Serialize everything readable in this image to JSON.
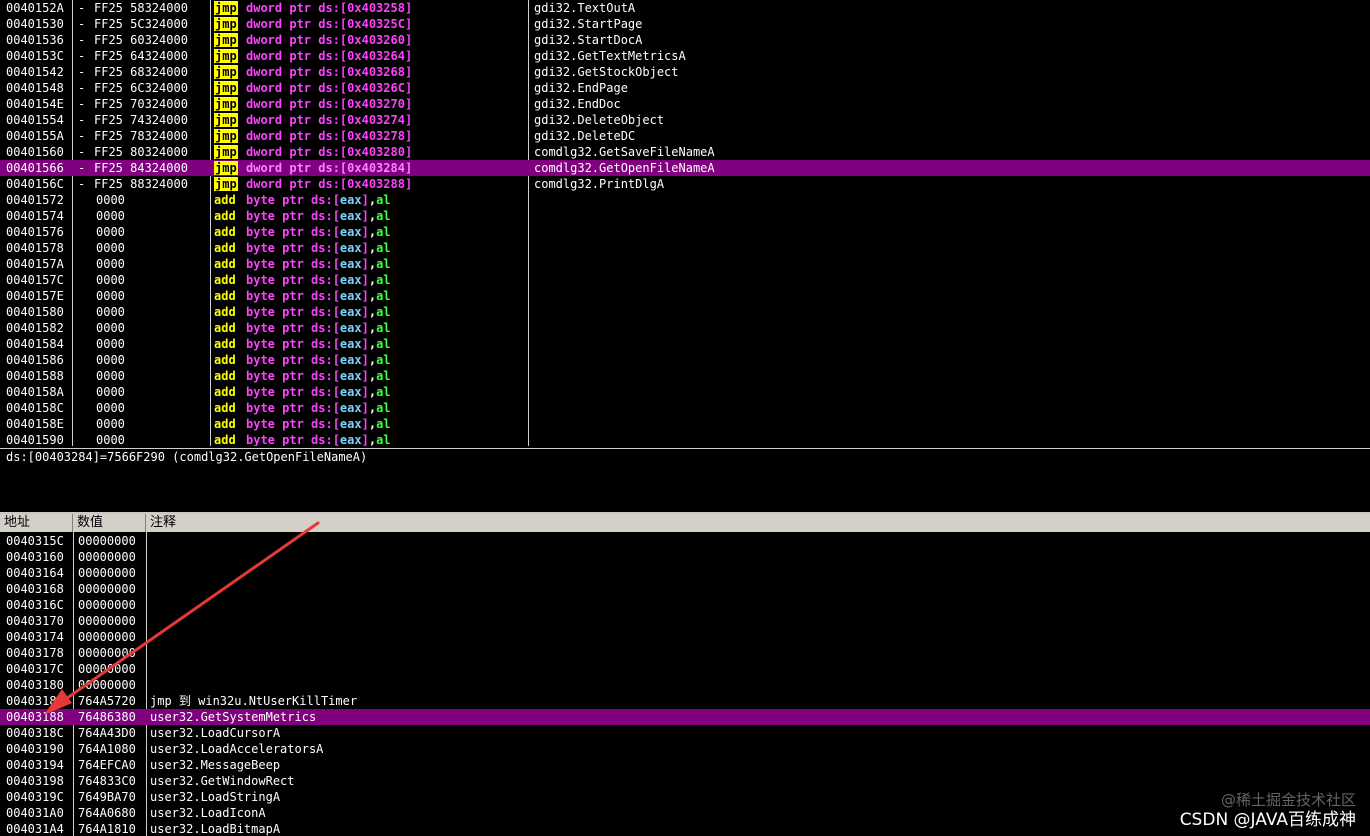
{
  "colors": {
    "selection": "#800080",
    "jmp_highlight": "#ffff00",
    "operand_ptr": "#ff40ff",
    "register_al": "#3fff3f",
    "header_bg": "#d4d0c8",
    "arrow": "#e53935"
  },
  "disasm": {
    "rows": [
      {
        "addr": "0040152A",
        "dash": "-",
        "hex": "FF25 58324000",
        "mnem": "jmp",
        "op": "dword ptr ds:[0x403258]",
        "cmt": "gdi32.TextOutA",
        "sel": false
      },
      {
        "addr": "00401530",
        "dash": "-",
        "hex": "FF25 5C324000",
        "mnem": "jmp",
        "op": "dword ptr ds:[0x40325C]",
        "cmt": "gdi32.StartPage",
        "sel": false
      },
      {
        "addr": "00401536",
        "dash": "-",
        "hex": "FF25 60324000",
        "mnem": "jmp",
        "op": "dword ptr ds:[0x403260]",
        "cmt": "gdi32.StartDocA",
        "sel": false
      },
      {
        "addr": "0040153C",
        "dash": "-",
        "hex": "FF25 64324000",
        "mnem": "jmp",
        "op": "dword ptr ds:[0x403264]",
        "cmt": "gdi32.GetTextMetricsA",
        "sel": false
      },
      {
        "addr": "00401542",
        "dash": "-",
        "hex": "FF25 68324000",
        "mnem": "jmp",
        "op": "dword ptr ds:[0x403268]",
        "cmt": "gdi32.GetStockObject",
        "sel": false
      },
      {
        "addr": "00401548",
        "dash": "-",
        "hex": "FF25 6C324000",
        "mnem": "jmp",
        "op": "dword ptr ds:[0x40326C]",
        "cmt": "gdi32.EndPage",
        "sel": false
      },
      {
        "addr": "0040154E",
        "dash": "-",
        "hex": "FF25 70324000",
        "mnem": "jmp",
        "op": "dword ptr ds:[0x403270]",
        "cmt": "gdi32.EndDoc",
        "sel": false
      },
      {
        "addr": "00401554",
        "dash": "-",
        "hex": "FF25 74324000",
        "mnem": "jmp",
        "op": "dword ptr ds:[0x403274]",
        "cmt": "gdi32.DeleteObject",
        "sel": false
      },
      {
        "addr": "0040155A",
        "dash": "-",
        "hex": "FF25 78324000",
        "mnem": "jmp",
        "op": "dword ptr ds:[0x403278]",
        "cmt": "gdi32.DeleteDC",
        "sel": false
      },
      {
        "addr": "00401560",
        "dash": "-",
        "hex": "FF25 80324000",
        "mnem": "jmp",
        "op": "dword ptr ds:[0x403280]",
        "cmt": "comdlg32.GetSaveFileNameA",
        "sel": false
      },
      {
        "addr": "00401566",
        "dash": "-",
        "hex": "FF25 84324000",
        "mnem": "jmp",
        "op": "dword ptr ds:[0x403284]",
        "cmt": "comdlg32.GetOpenFileNameA",
        "sel": true
      },
      {
        "addr": "0040156C",
        "dash": "-",
        "hex": "FF25 88324000",
        "mnem": "jmp",
        "op": "dword ptr ds:[0x403288]",
        "cmt": "comdlg32.PrintDlgA",
        "sel": false
      },
      {
        "addr": "00401572",
        "dash": "",
        "hex": "0000",
        "mnem": "add",
        "op": "byte ptr ds:[eax],al",
        "cmt": "",
        "sel": false
      },
      {
        "addr": "00401574",
        "dash": "",
        "hex": "0000",
        "mnem": "add",
        "op": "byte ptr ds:[eax],al",
        "cmt": "",
        "sel": false
      },
      {
        "addr": "00401576",
        "dash": "",
        "hex": "0000",
        "mnem": "add",
        "op": "byte ptr ds:[eax],al",
        "cmt": "",
        "sel": false
      },
      {
        "addr": "00401578",
        "dash": "",
        "hex": "0000",
        "mnem": "add",
        "op": "byte ptr ds:[eax],al",
        "cmt": "",
        "sel": false
      },
      {
        "addr": "0040157A",
        "dash": "",
        "hex": "0000",
        "mnem": "add",
        "op": "byte ptr ds:[eax],al",
        "cmt": "",
        "sel": false
      },
      {
        "addr": "0040157C",
        "dash": "",
        "hex": "0000",
        "mnem": "add",
        "op": "byte ptr ds:[eax],al",
        "cmt": "",
        "sel": false
      },
      {
        "addr": "0040157E",
        "dash": "",
        "hex": "0000",
        "mnem": "add",
        "op": "byte ptr ds:[eax],al",
        "cmt": "",
        "sel": false
      },
      {
        "addr": "00401580",
        "dash": "",
        "hex": "0000",
        "mnem": "add",
        "op": "byte ptr ds:[eax],al",
        "cmt": "",
        "sel": false
      },
      {
        "addr": "00401582",
        "dash": "",
        "hex": "0000",
        "mnem": "add",
        "op": "byte ptr ds:[eax],al",
        "cmt": "",
        "sel": false
      },
      {
        "addr": "00401584",
        "dash": "",
        "hex": "0000",
        "mnem": "add",
        "op": "byte ptr ds:[eax],al",
        "cmt": "",
        "sel": false
      },
      {
        "addr": "00401586",
        "dash": "",
        "hex": "0000",
        "mnem": "add",
        "op": "byte ptr ds:[eax],al",
        "cmt": "",
        "sel": false
      },
      {
        "addr": "00401588",
        "dash": "",
        "hex": "0000",
        "mnem": "add",
        "op": "byte ptr ds:[eax],al",
        "cmt": "",
        "sel": false
      },
      {
        "addr": "0040158A",
        "dash": "",
        "hex": "0000",
        "mnem": "add",
        "op": "byte ptr ds:[eax],al",
        "cmt": "",
        "sel": false
      },
      {
        "addr": "0040158C",
        "dash": "",
        "hex": "0000",
        "mnem": "add",
        "op": "byte ptr ds:[eax],al",
        "cmt": "",
        "sel": false
      },
      {
        "addr": "0040158E",
        "dash": "",
        "hex": "0000",
        "mnem": "add",
        "op": "byte ptr ds:[eax],al",
        "cmt": "",
        "sel": false
      },
      {
        "addr": "00401590",
        "dash": "",
        "hex": "0000",
        "mnem": "add",
        "op": "byte ptr ds:[eax],al",
        "cmt": "",
        "sel": false
      }
    ]
  },
  "info": {
    "text": "ds:[00403284]=7566F290 (comdlg32.GetOpenFileNameA)"
  },
  "dump": {
    "headers": {
      "address": "地址",
      "value": "数值",
      "comment": "注释"
    },
    "rows": [
      {
        "addr": "0040315C",
        "val": "00000000",
        "cmt": "",
        "sel": false
      },
      {
        "addr": "00403160",
        "val": "00000000",
        "cmt": "",
        "sel": false
      },
      {
        "addr": "00403164",
        "val": "00000000",
        "cmt": "",
        "sel": false
      },
      {
        "addr": "00403168",
        "val": "00000000",
        "cmt": "",
        "sel": false
      },
      {
        "addr": "0040316C",
        "val": "00000000",
        "cmt": "",
        "sel": false
      },
      {
        "addr": "00403170",
        "val": "00000000",
        "cmt": "",
        "sel": false
      },
      {
        "addr": "00403174",
        "val": "00000000",
        "cmt": "",
        "sel": false
      },
      {
        "addr": "00403178",
        "val": "00000000",
        "cmt": "",
        "sel": false
      },
      {
        "addr": "0040317C",
        "val": "00000000",
        "cmt": "",
        "sel": false
      },
      {
        "addr": "00403180",
        "val": "00000000",
        "cmt": "",
        "sel": false
      },
      {
        "addr": "00403184",
        "val": "764A5720",
        "cmt": "jmp 到 win32u.NtUserKillTimer",
        "sel": false
      },
      {
        "addr": "00403188",
        "val": "76486380",
        "cmt": "user32.GetSystemMetrics",
        "sel": true
      },
      {
        "addr": "0040318C",
        "val": "764A43D0",
        "cmt": "user32.LoadCursorA",
        "sel": false
      },
      {
        "addr": "00403190",
        "val": "764A1080",
        "cmt": "user32.LoadAcceleratorsA",
        "sel": false
      },
      {
        "addr": "00403194",
        "val": "764EFCA0",
        "cmt": "user32.MessageBeep",
        "sel": false
      },
      {
        "addr": "00403198",
        "val": "764833C0",
        "cmt": "user32.GetWindowRect",
        "sel": false
      },
      {
        "addr": "0040319C",
        "val": "7649BA70",
        "cmt": "user32.LoadStringA",
        "sel": false
      },
      {
        "addr": "004031A0",
        "val": "764A0680",
        "cmt": "user32.LoadIconA",
        "sel": false
      },
      {
        "addr": "004031A4",
        "val": "764A1810",
        "cmt": "user32.LoadBitmapA",
        "sel": false
      }
    ]
  },
  "watermarks": {
    "line1": "@稀土掘金技术社区",
    "line2": "CSDN @JAVA百练成神"
  },
  "annotation": {
    "arrow_icon": "red-arrow-icon"
  }
}
